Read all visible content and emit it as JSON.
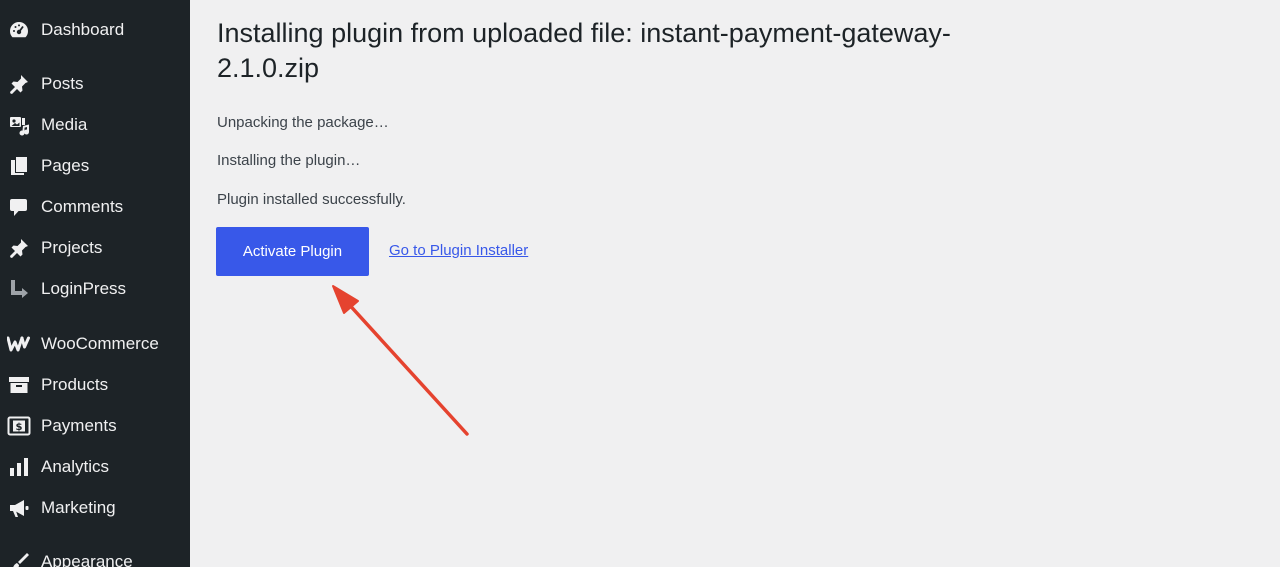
{
  "sidebar": {
    "items": [
      {
        "label": "Dashboard",
        "icon": "dashboard-icon"
      },
      {
        "label": "Posts",
        "icon": "pushpin-icon"
      },
      {
        "label": "Media",
        "icon": "media-icon"
      },
      {
        "label": "Pages",
        "icon": "pages-icon"
      },
      {
        "label": "Comments",
        "icon": "comment-icon"
      },
      {
        "label": "Projects",
        "icon": "pushpin-icon"
      },
      {
        "label": "LoginPress",
        "icon": "loginpress-icon"
      },
      {
        "label": "WooCommerce",
        "icon": "woocommerce-icon"
      },
      {
        "label": "Products",
        "icon": "archive-box-icon"
      },
      {
        "label": "Payments",
        "icon": "dollar-icon"
      },
      {
        "label": "Analytics",
        "icon": "bar-chart-icon"
      },
      {
        "label": "Marketing",
        "icon": "megaphone-icon"
      },
      {
        "label": "Appearance",
        "icon": "paintbrush-icon"
      }
    ]
  },
  "main": {
    "title": "Installing plugin from uploaded file: instant-payment-gateway-2.1.0.zip",
    "status_lines": [
      "Unpacking the package…",
      "Installing the plugin…",
      "Plugin installed successfully."
    ],
    "activate_label": "Activate Plugin",
    "installer_link_label": "Go to Plugin Installer"
  },
  "colors": {
    "sidebar_bg": "#1d2327",
    "content_bg": "#f0f0f1",
    "accent": "#3858e9",
    "annotation_arrow": "#e5432f"
  }
}
